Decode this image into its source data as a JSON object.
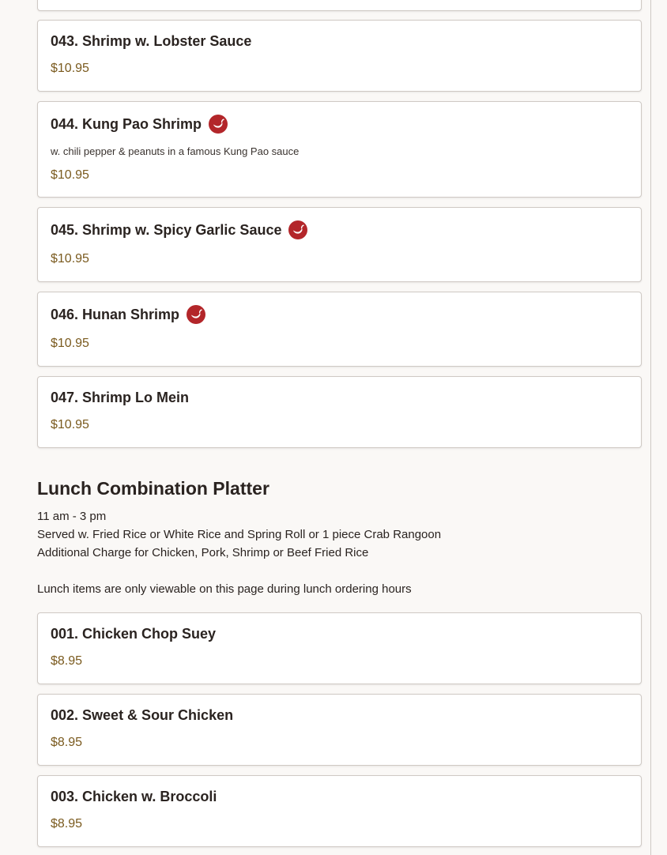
{
  "shrimp_items": [
    {
      "name": "043. Shrimp w. Lobster Sauce",
      "price": "$10.95",
      "spicy": false
    },
    {
      "name": "044. Kung Pao Shrimp",
      "price": "$10.95",
      "spicy": true,
      "description": "w. chili pepper & peanuts in a famous Kung Pao sauce"
    },
    {
      "name": "045. Shrimp w. Spicy Garlic Sauce",
      "price": "$10.95",
      "spicy": true
    },
    {
      "name": "046. Hunan Shrimp",
      "price": "$10.95",
      "spicy": true
    },
    {
      "name": "047. Shrimp Lo Mein",
      "price": "$10.95",
      "spicy": false
    }
  ],
  "lunch_section": {
    "title": "Lunch Combination Platter",
    "hours": "11 am - 3 pm",
    "served_with": "Served w. Fried Rice or White Rice and Spring Roll or 1 piece Crab Rangoon",
    "additional_charge": "Additional Charge for Chicken, Pork, Shrimp or Beef Fried Rice",
    "notice": "Lunch items are only viewable on this page during lunch ordering hours",
    "items": [
      {
        "name": "001. Chicken Chop Suey",
        "price": "$8.95"
      },
      {
        "name": "002. Sweet & Sour Chicken",
        "price": "$8.95"
      },
      {
        "name": "003. Chicken w. Broccoli",
        "price": "$8.95"
      }
    ]
  },
  "colors": {
    "spicy_icon": "#b3262a",
    "price": "#7a5a1e",
    "card_border": "#cfc9c4"
  }
}
